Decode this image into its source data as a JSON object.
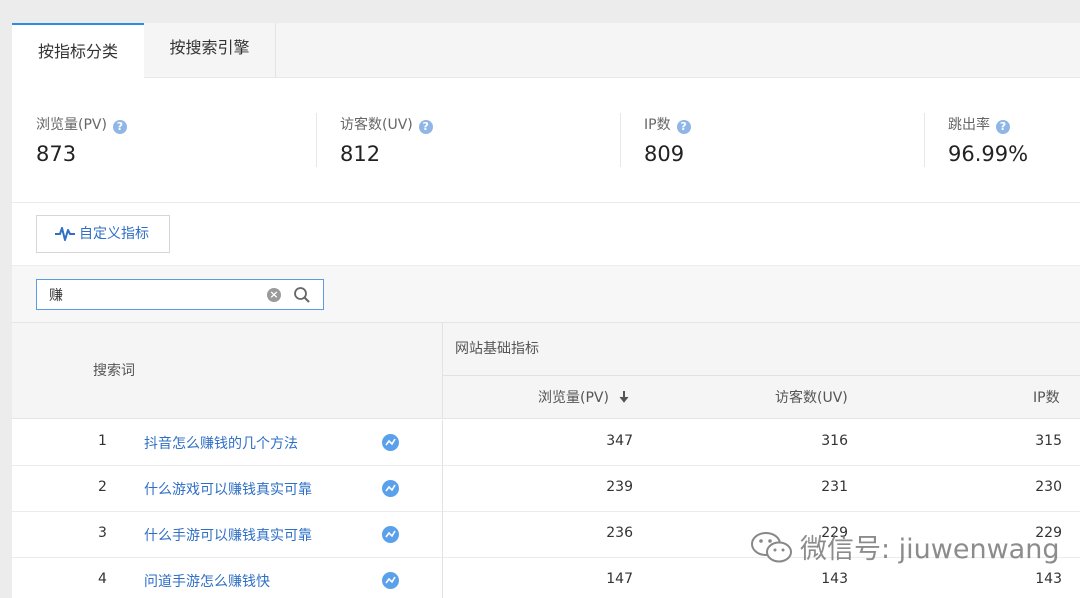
{
  "tabs": [
    {
      "label": "按指标分类"
    },
    {
      "label": "按搜索引擎"
    }
  ],
  "stats": [
    {
      "label": "浏览量(PV)",
      "value": "873"
    },
    {
      "label": "访客数(UV)",
      "value": "812"
    },
    {
      "label": "IP数",
      "value": "809"
    },
    {
      "label": "跳出率",
      "value": "96.99%"
    }
  ],
  "custom_button": {
    "label": "自定义指标"
  },
  "search": {
    "value": "赚"
  },
  "table": {
    "keyword_header": "搜索词",
    "group_header": "网站基础指标",
    "columns": [
      "浏览量(PV)",
      "访客数(UV)",
      "IP数"
    ],
    "rows": [
      {
        "index": "1",
        "keyword": "抖音怎么赚钱的几个方法",
        "pv": "347",
        "uv": "316",
        "ip": "315"
      },
      {
        "index": "2",
        "keyword": "什么游戏可以赚钱真实可靠",
        "pv": "239",
        "uv": "231",
        "ip": "230"
      },
      {
        "index": "3",
        "keyword": "什么手游可以赚钱真实可靠",
        "pv": "236",
        "uv": "229",
        "ip": "229"
      },
      {
        "index": "4",
        "keyword": "问道手游怎么赚钱快",
        "pv": "147",
        "uv": "143",
        "ip": "143"
      }
    ]
  },
  "watermark": {
    "text": "微信号: jiuwenwang"
  },
  "colors": {
    "accent": "#2f8be6",
    "link": "#2f6fc6",
    "trend_icon": "#5aa0ea"
  }
}
